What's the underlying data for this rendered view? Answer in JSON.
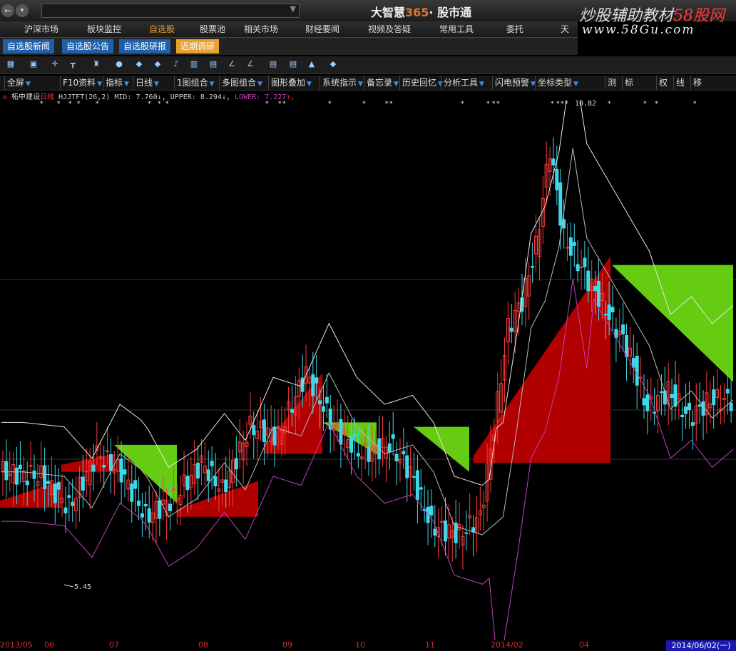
{
  "window": {
    "brand_name": "大智慧",
    "brand_num": "365",
    "brand_sep": "·",
    "brand_product": "股市通",
    "watermark_text": "炒股辅助教材",
    "watermark_site": "58股网",
    "watermark_url": "www.58Gu.com"
  },
  "menu": [
    "沪深市场",
    "板块监控",
    "自选股",
    "股票池",
    "相关市场",
    "财经要闻",
    "视频及答疑",
    "常用工具",
    "委托",
    "天道"
  ],
  "menu_active": "自选股",
  "subtabs": [
    "自选股新闻",
    "自选股公告",
    "自选股研报",
    "近期调研"
  ],
  "subtab_active": "近期调研",
  "funcbar": [
    "全屏",
    "F10资料",
    "指标",
    "日线",
    "1图组合",
    "多图组合",
    "图形叠加",
    "系统指示",
    "备忘录",
    "历史回忆",
    "分析工具",
    "闪电预警",
    "坐标类型",
    "测",
    "标",
    "权",
    "线",
    "移"
  ],
  "info": {
    "stock": "柘中建设",
    "period": "日线",
    "indicator": "HJJTFT(26,2)",
    "mid_label": "MID:",
    "mid": "7.760",
    "upper_label": "UPPER:",
    "upper": "8.294",
    "lower_label": "LOWER:",
    "lower": "7.227"
  },
  "chart_labels": {
    "high": "10.82",
    "low": "5.45"
  },
  "axis": {
    "labels": [
      "2013/05",
      "06",
      "07",
      "08",
      "09",
      "10",
      "11",
      "2014/02",
      "04"
    ],
    "date": "2014/06/02(一)"
  },
  "chart_data": {
    "type": "candlestick",
    "high_marker": 10.82,
    "low_marker": 5.45,
    "indicator": "HJJTFT(26,2)",
    "mid": 7.76,
    "upper": 8.294,
    "lower": 7.227
  },
  "colors": {
    "up": "#ff3b3b",
    "down": "#3fd8e8",
    "red_fill": "#b00000",
    "green_fill": "#66cc11",
    "upper_line": "#e8e8e8",
    "lower_line": "#c040c0"
  }
}
